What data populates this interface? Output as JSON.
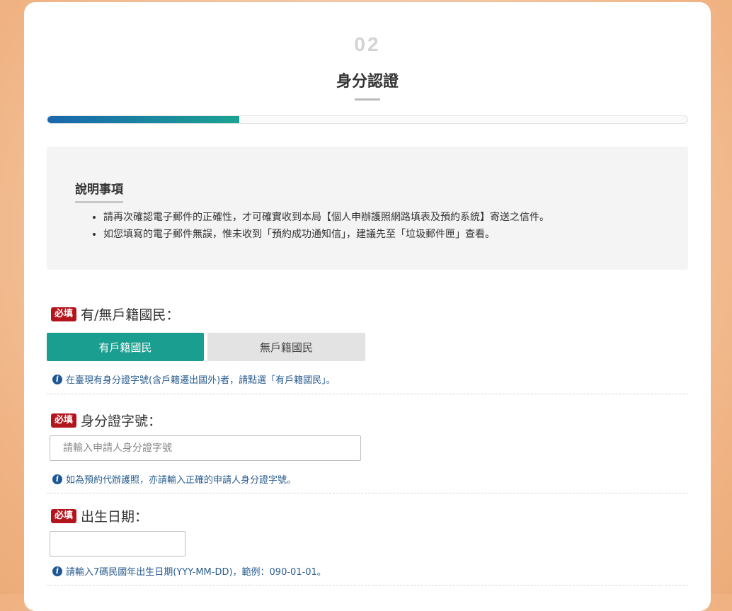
{
  "step": {
    "number": "02",
    "title": "身分認證",
    "progress_fraction": 0.3
  },
  "notice": {
    "title": "說明事項",
    "items": [
      "請再次確認電子郵件的正確性，才可確實收到本局【個人申辦護照網路填表及預約系統】寄送之信件。",
      "如您填寫的電子郵件無誤，惟未收到「預約成功通知信」，建議先至「垃圾郵件匣」查看。"
    ]
  },
  "required_badge": "必填",
  "household": {
    "label": "有/無戶籍國民：",
    "options": [
      "有戶籍國民",
      "無戶籍國民"
    ],
    "selected": "有戶籍國民",
    "hint": "在臺現有身分證字號(含戶籍遷出國外)者，請點選「有戶籍國民」。"
  },
  "id_number": {
    "label": "身分證字號：",
    "placeholder": "請輸入申請人身分證字號",
    "value": "",
    "hint": "如為預約代辦護照，亦請輸入正確的申請人身分證字號。"
  },
  "birth_date": {
    "label": "出生日期：",
    "value": "",
    "hint": "請輸入7碼民國年出生日期(YYY-MM-DD)，範例：090-01-01。"
  },
  "colors": {
    "accent": "#1a9e8f",
    "progress_start": "#1a67ad",
    "required": "#b3151c",
    "hint_text": "#2a5d8f"
  },
  "icons": [
    "info-icon"
  ]
}
